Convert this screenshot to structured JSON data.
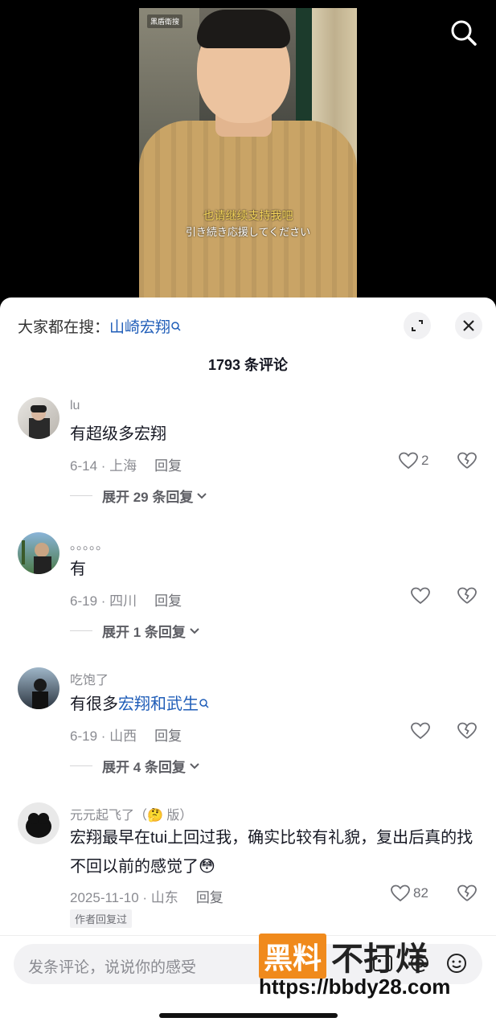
{
  "video": {
    "brand_badge": "黑盾衛搜",
    "subtitle_cn": "也请继续支持我吧",
    "subtitle_jp": "引き続き応援してください",
    "search_icon": "search-icon"
  },
  "sheet": {
    "hot_search_prefix": "大家都在搜：",
    "hot_search_term": "山崎宏翔",
    "comment_count": "1793 条评论"
  },
  "comments": [
    {
      "user": "lu",
      "text": "有超级多宏翔",
      "date": "6-14 · 上海",
      "reply": "回复",
      "likes": "2",
      "expand": "展开 29 条回复"
    },
    {
      "user": "。。。。。",
      "text": "有",
      "date": "6-19 · 四川",
      "reply": "回复",
      "likes": "",
      "expand": "展开 1 条回复"
    },
    {
      "user": "吃饱了",
      "text_prefix": "有很多",
      "text_link": "宏翔和武生",
      "date": "6-19 · 山西",
      "reply": "回复",
      "likes": "",
      "expand": "展开 4 条回复"
    },
    {
      "user": "元元起飞了（🤔 版）",
      "text": "宏翔最早在tui上回过我，确实比较有礼貌，复出后真的找不回以前的感觉了😳",
      "date": "2025-11-10 · 山东",
      "reply": "回复",
      "likes": "82",
      "tag": "作者回复过"
    }
  ],
  "input": {
    "placeholder": "发条评论，说说你的感受"
  },
  "watermark": {
    "box": "黑料",
    "text": "不打烊",
    "url": "https://bbdy28.com"
  }
}
